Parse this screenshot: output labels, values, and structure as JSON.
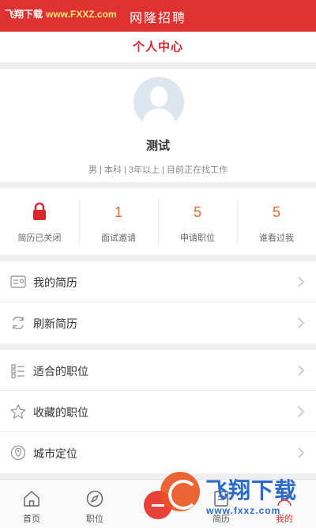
{
  "statusbar": {
    "watermark_name": "飞翔下载",
    "watermark_url": "www.FXXZ.com"
  },
  "app": {
    "title": "网隆招聘"
  },
  "header": {
    "title": "个人中心"
  },
  "profile": {
    "name": "测试",
    "info": "男 | 本科 | 3年以上 | 目前正在找工作"
  },
  "stats": [
    {
      "icon": "lock-icon",
      "value": "",
      "label": "简历已关闭"
    },
    {
      "value": "1",
      "label": "面试邀请"
    },
    {
      "value": "5",
      "label": "申请职位"
    },
    {
      "value": "5",
      "label": "谁看过我"
    }
  ],
  "menu_group1": [
    {
      "icon": "resume-icon",
      "label": "我的简历"
    },
    {
      "icon": "refresh-icon",
      "label": "刷新简历"
    }
  ],
  "menu_group2": [
    {
      "icon": "list-icon",
      "label": "适合的职位"
    },
    {
      "icon": "star-icon",
      "label": "收藏的职位"
    },
    {
      "icon": "location-icon",
      "label": "城市定位"
    }
  ],
  "tabbar": {
    "tabs": [
      {
        "icon": "home-icon",
        "label": "首页"
      },
      {
        "icon": "compass-icon",
        "label": "职位"
      },
      {
        "icon": "add-icon",
        "label": ""
      },
      {
        "icon": "resume-icon",
        "label": "简历"
      },
      {
        "icon": "user-icon",
        "label": "我的"
      }
    ],
    "active_index": 4
  },
  "watermark": {
    "brand": "飞翔下载",
    "url": "www.fxxz.com"
  },
  "colors": {
    "brand_red": "#e03131",
    "accent_orange": "#e26a36",
    "watermark_blue": "#2a6ac9"
  }
}
